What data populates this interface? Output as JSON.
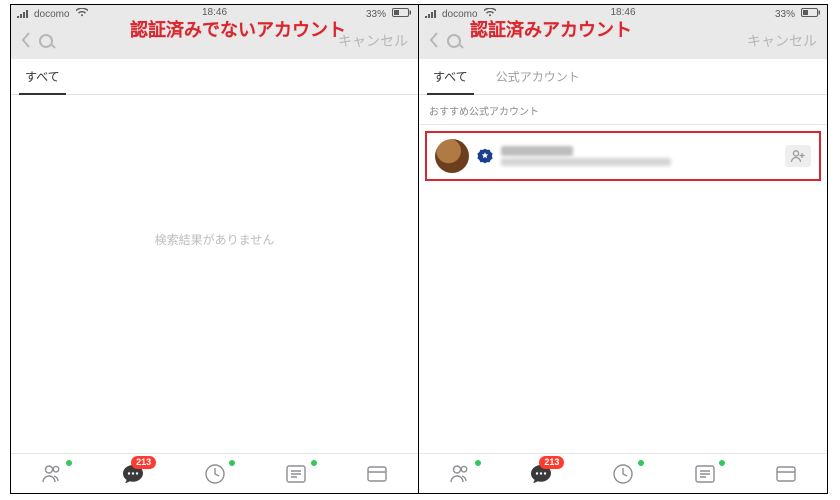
{
  "annotation": {
    "unverified": "認証済みでないアカウント",
    "verified": "認証済みアカウント"
  },
  "status_bar": {
    "carrier": "docomo",
    "clock": "18:46",
    "battery_pct": "33%"
  },
  "search": {
    "placeholder_left": "",
    "placeholder_right": "",
    "cancel": "キャンセル"
  },
  "tabs": {
    "all": "すべて",
    "official": "公式アカウント"
  },
  "left_panel": {
    "empty": "検索結果がありません"
  },
  "right_panel": {
    "section_title": "おすすめ公式アカウント"
  },
  "nav": {
    "chat_badge": "213"
  }
}
